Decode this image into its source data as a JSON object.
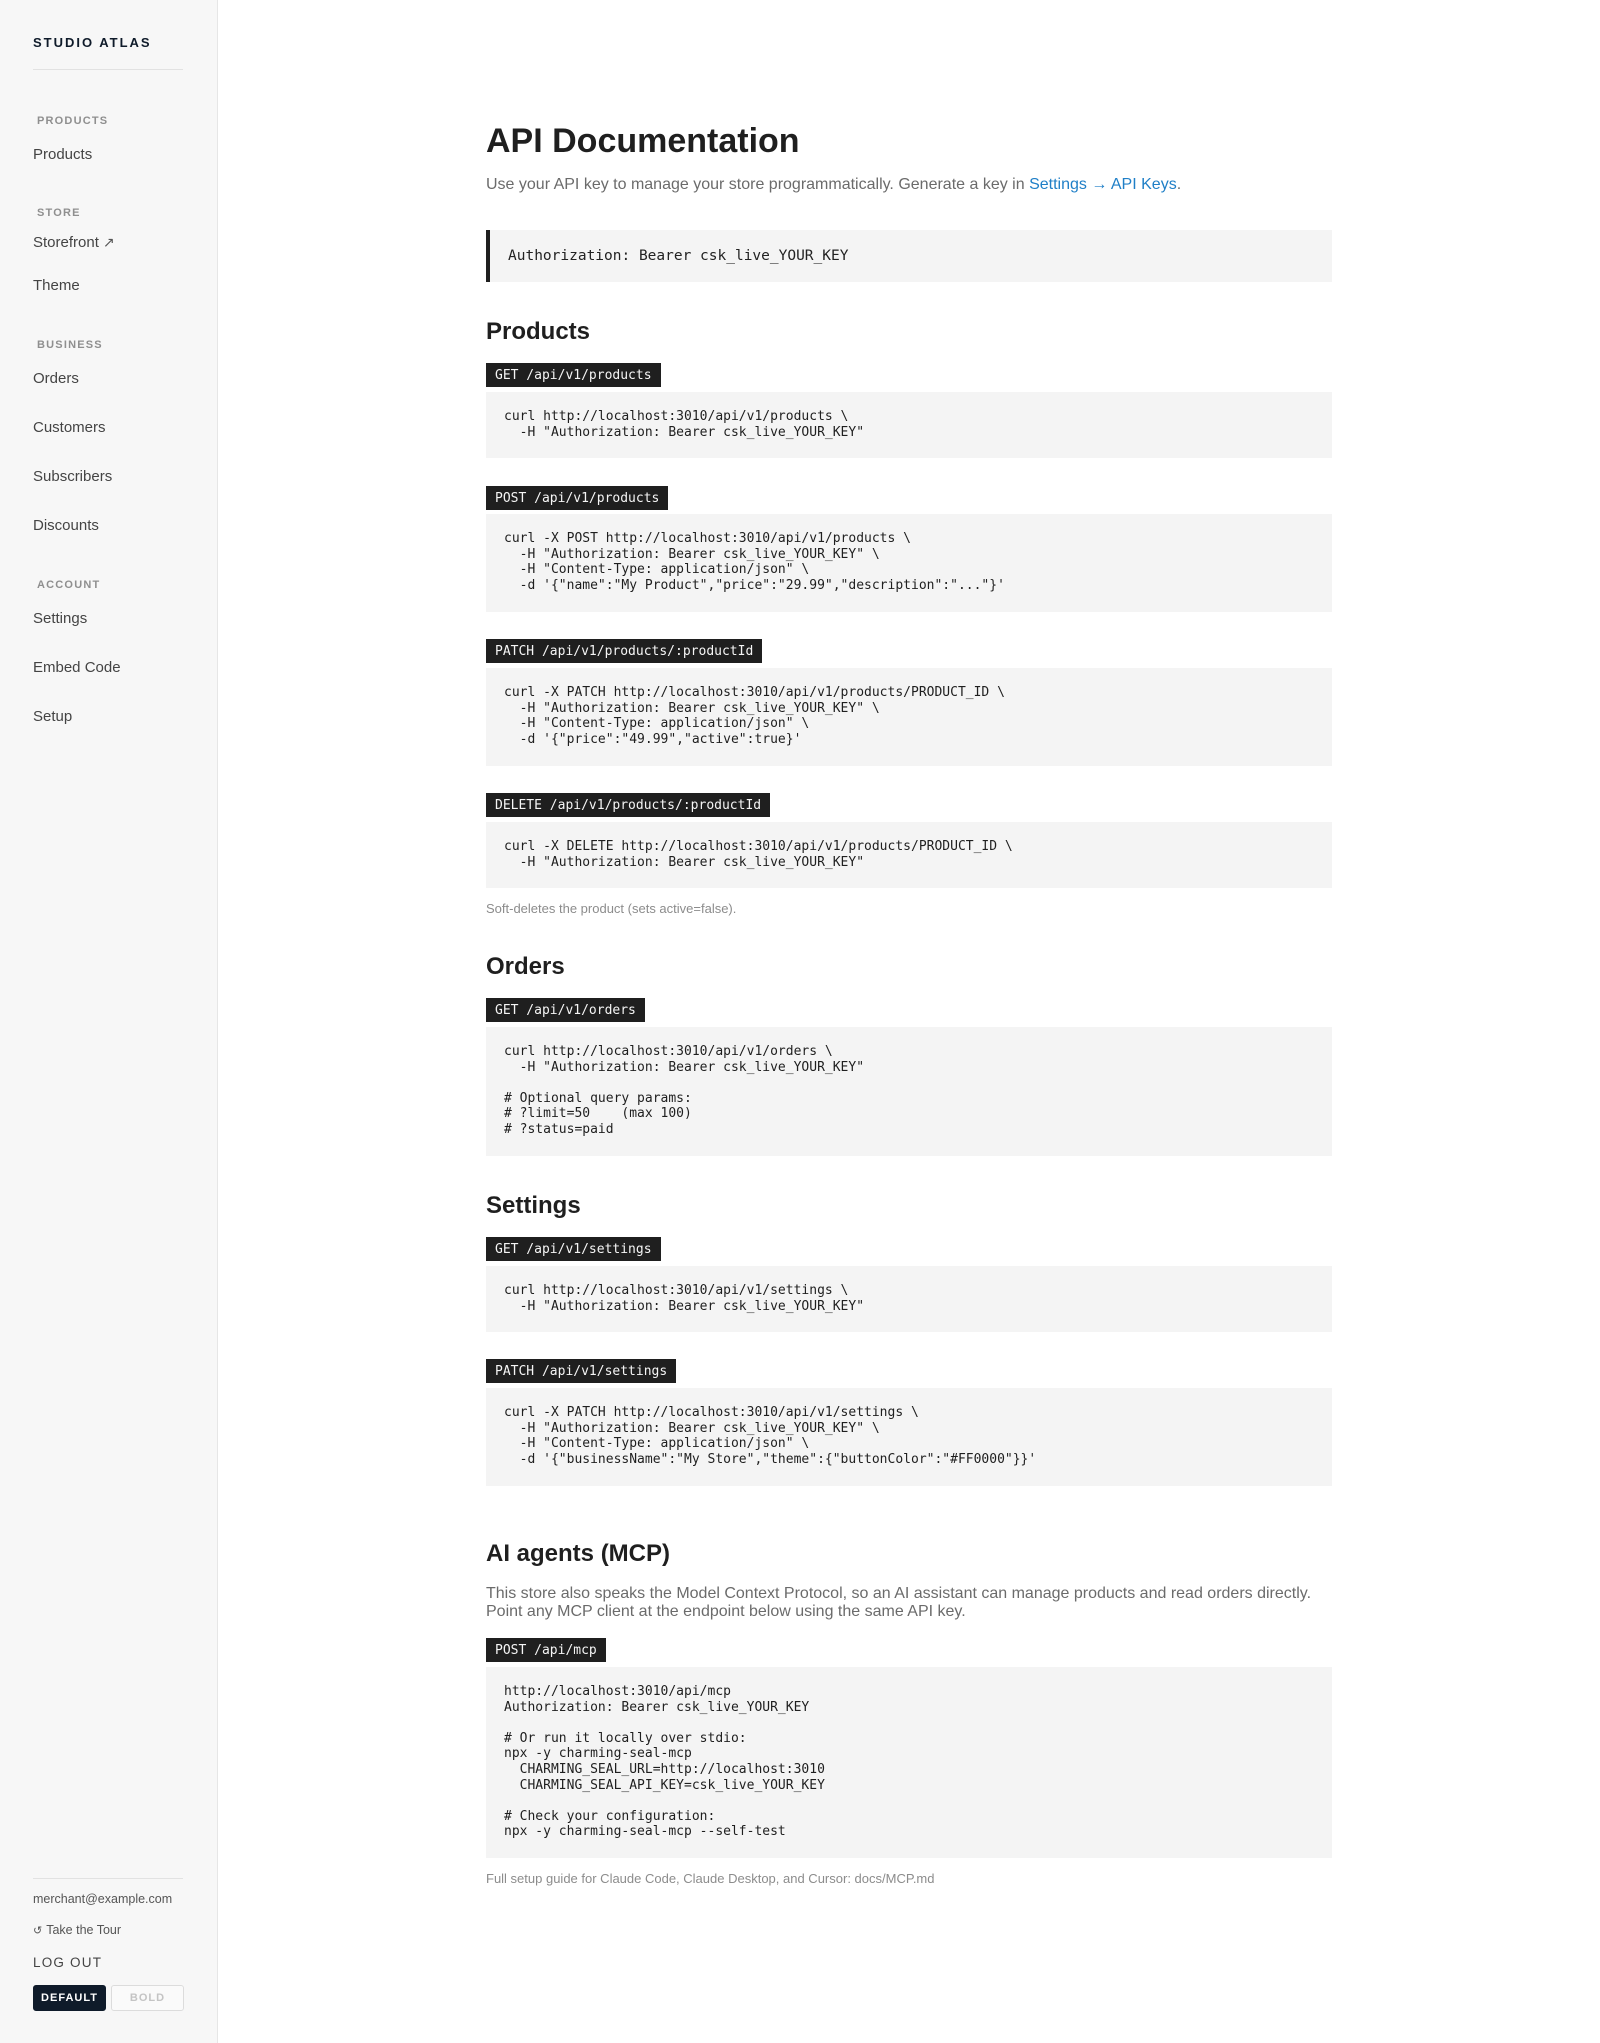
{
  "sidebar": {
    "brand": "STUDIO ATLAS",
    "sections": {
      "products": {
        "label": "PRODUCTS",
        "items": [
          "Products"
        ]
      },
      "store": {
        "label": "STORE",
        "items": [
          "Storefront",
          "Theme"
        ],
        "storefront_arrow": "↗"
      },
      "business": {
        "label": "BUSINESS",
        "items": [
          "Orders",
          "Customers",
          "Subscribers",
          "Discounts"
        ]
      },
      "account": {
        "label": "ACCOUNT",
        "items": [
          "Settings",
          "Embed Code",
          "Setup"
        ]
      }
    },
    "footer": {
      "email": "merchant@example.com",
      "tour_icon": "↺",
      "tour": "Take the Tour",
      "logout": "LOG OUT",
      "theme_default": "DEFAULT",
      "theme_bold": "BOLD"
    }
  },
  "main": {
    "title": "API Documentation",
    "intro_text": "Use your API key to manage your store programmatically. Generate a key in ",
    "intro_link": "Settings → API Keys",
    "intro_end": ".",
    "auth_header": "Authorization: Bearer csk_live_YOUR_KEY",
    "products": {
      "heading": "Products",
      "endpoints": [
        {
          "label": "GET /api/v1/products",
          "code": "curl http://localhost:3010/api/v1/products \\\n  -H \"Authorization: Bearer csk_live_YOUR_KEY\""
        },
        {
          "label": "POST /api/v1/products",
          "code": "curl -X POST http://localhost:3010/api/v1/products \\\n  -H \"Authorization: Bearer csk_live_YOUR_KEY\" \\\n  -H \"Content-Type: application/json\" \\\n  -d '{\"name\":\"My Product\",\"price\":\"29.99\",\"description\":\"...\"}'"
        },
        {
          "label": "PATCH /api/v1/products/:productId",
          "code": "curl -X PATCH http://localhost:3010/api/v1/products/PRODUCT_ID \\\n  -H \"Authorization: Bearer csk_live_YOUR_KEY\" \\\n  -H \"Content-Type: application/json\" \\\n  -d '{\"price\":\"49.99\",\"active\":true}'"
        },
        {
          "label": "DELETE /api/v1/products/:productId",
          "code": "curl -X DELETE http://localhost:3010/api/v1/products/PRODUCT_ID \\\n  -H \"Authorization: Bearer csk_live_YOUR_KEY\""
        }
      ],
      "delete_note": "Soft-deletes the product (sets active=false)."
    },
    "orders": {
      "heading": "Orders",
      "endpoints": [
        {
          "label": "GET /api/v1/orders",
          "code": "curl http://localhost:3010/api/v1/orders \\\n  -H \"Authorization: Bearer csk_live_YOUR_KEY\"\n\n# Optional query params:\n# ?limit=50    (max 100)\n# ?status=paid"
        }
      ]
    },
    "settings": {
      "heading": "Settings",
      "endpoints": [
        {
          "label": "GET /api/v1/settings",
          "code": "curl http://localhost:3010/api/v1/settings \\\n  -H \"Authorization: Bearer csk_live_YOUR_KEY\""
        },
        {
          "label": "PATCH /api/v1/settings",
          "code": "curl -X PATCH http://localhost:3010/api/v1/settings \\\n  -H \"Authorization: Bearer csk_live_YOUR_KEY\" \\\n  -H \"Content-Type: application/json\" \\\n  -d '{\"businessName\":\"My Store\",\"theme\":{\"buttonColor\":\"#FF0000\"}}'"
        }
      ]
    },
    "mcp": {
      "heading": "AI agents (MCP)",
      "intro": "This store also speaks the Model Context Protocol, so an AI assistant can manage products and read orders directly. Point any MCP client at the endpoint below using the same API key.",
      "endpoint_label": "POST /api/mcp",
      "code": "http://localhost:3010/api/mcp\nAuthorization: Bearer csk_live_YOUR_KEY\n\n# Or run it locally over stdio:\nnpx -y charming-seal-mcp\n  CHARMING_SEAL_URL=http://localhost:3010\n  CHARMING_SEAL_API_KEY=csk_live_YOUR_KEY\n\n# Check your configuration:\nnpx -y charming-seal-mcp --self-test",
      "footer_note": "Full setup guide for Claude Code, Claude Desktop, and Cursor: docs/MCP.md"
    }
  },
  "colors": {
    "accent_link": "#1f7fc7",
    "dark": "#1f1f1f",
    "navy": "#0f1b2a",
    "code_bg": "#f4f4f4",
    "sidebar_bg": "#f7f7f7"
  }
}
